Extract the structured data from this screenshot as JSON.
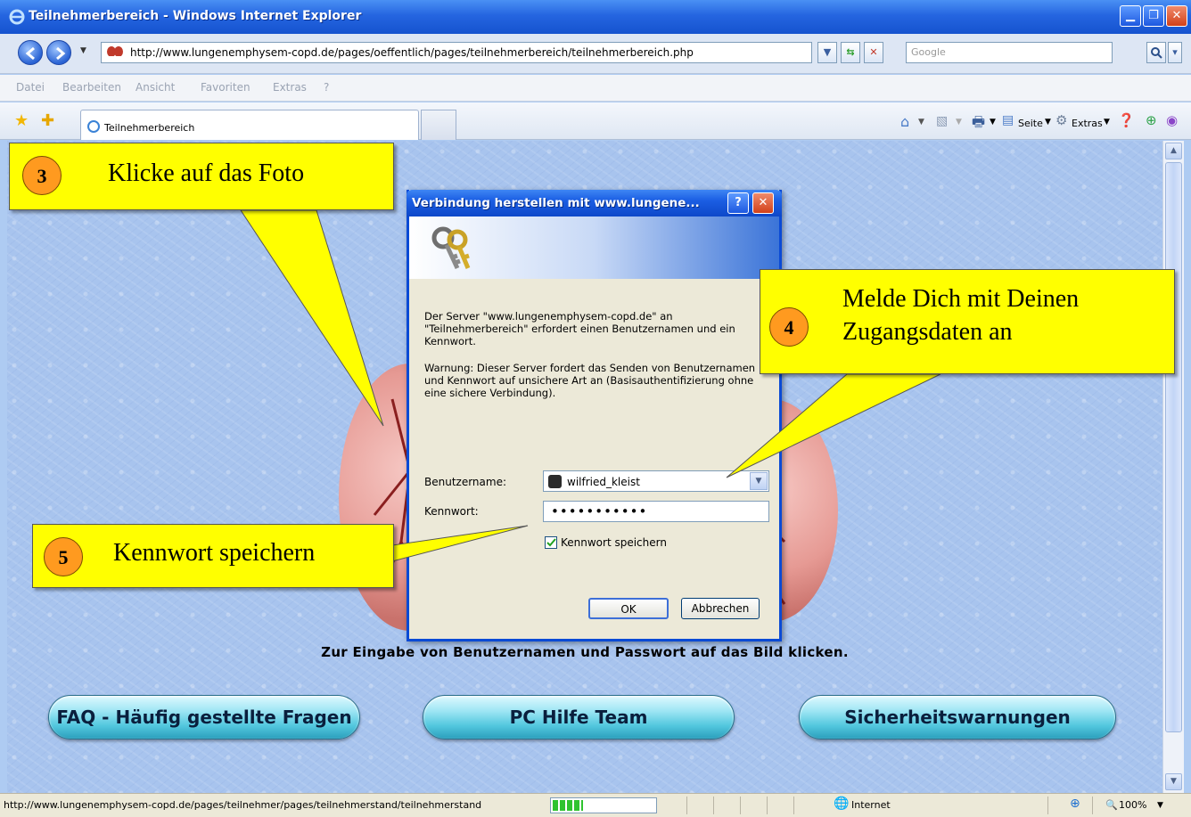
{
  "window": {
    "title": "Teilnehmerbereich - Windows Internet Explorer"
  },
  "address": {
    "url": "http://www.lungenemphysem-copd.de/pages/oeffentlich/pages/teilnehmerbereich/teilnehmerbereich.php",
    "search_placeholder": "Google"
  },
  "menu": [
    "Datei",
    "Bearbeiten",
    "Ansicht",
    "Favoriten",
    "Extras",
    "?"
  ],
  "tab": {
    "label": "Teilnehmerbereich"
  },
  "command_bar": {
    "page_label": "Seite",
    "tools_label": "Extras"
  },
  "page": {
    "caption": "Zur Eingabe von Benutzernamen und Passwort auf das Bild klicken.",
    "buttons": [
      "FAQ - Häufig gestellte Fragen",
      "PC Hilfe Team",
      "Sicherheitswarnungen"
    ]
  },
  "dialog": {
    "title": "Verbindung herstellen mit www.lungene...",
    "message_1": "Der Server \"www.lungenemphysem-copd.de\" an \"Teilnehmerbereich\" erfordert einen Benutzernamen und ein Kennwort.",
    "message_2": "Warnung: Dieser Server fordert das Senden von Benutzernamen und Kennwort auf unsichere Art an (Basisauthentifizierung ohne eine sichere Verbindung).",
    "username_label": "Benutzername:",
    "username_value": "wilfried_kleist",
    "password_label": "Kennwort:",
    "password_value": "•••••••••••",
    "remember_label": "Kennwort speichern",
    "remember_checked": true,
    "ok_label": "OK",
    "cancel_label": "Abbrechen"
  },
  "callouts": [
    {
      "number": "3",
      "text": "Klicke auf das Foto"
    },
    {
      "number": "4",
      "text": "Melde Dich mit Deinen Zugangsdaten an"
    },
    {
      "number": "5",
      "text": "Kennwort speichern"
    }
  ],
  "status": {
    "url": "http://www.lungenemphysem-copd.de/pages/teilnehmer/pages/teilnehmerstand/teilnehmerstand",
    "progress": 0.3,
    "zone": "Internet",
    "zoom": "100%"
  },
  "colors": {
    "callout": "#ffff00",
    "badge": "#ff9a1f",
    "titlebar": "#2565e0",
    "pill": "#52c7de"
  }
}
